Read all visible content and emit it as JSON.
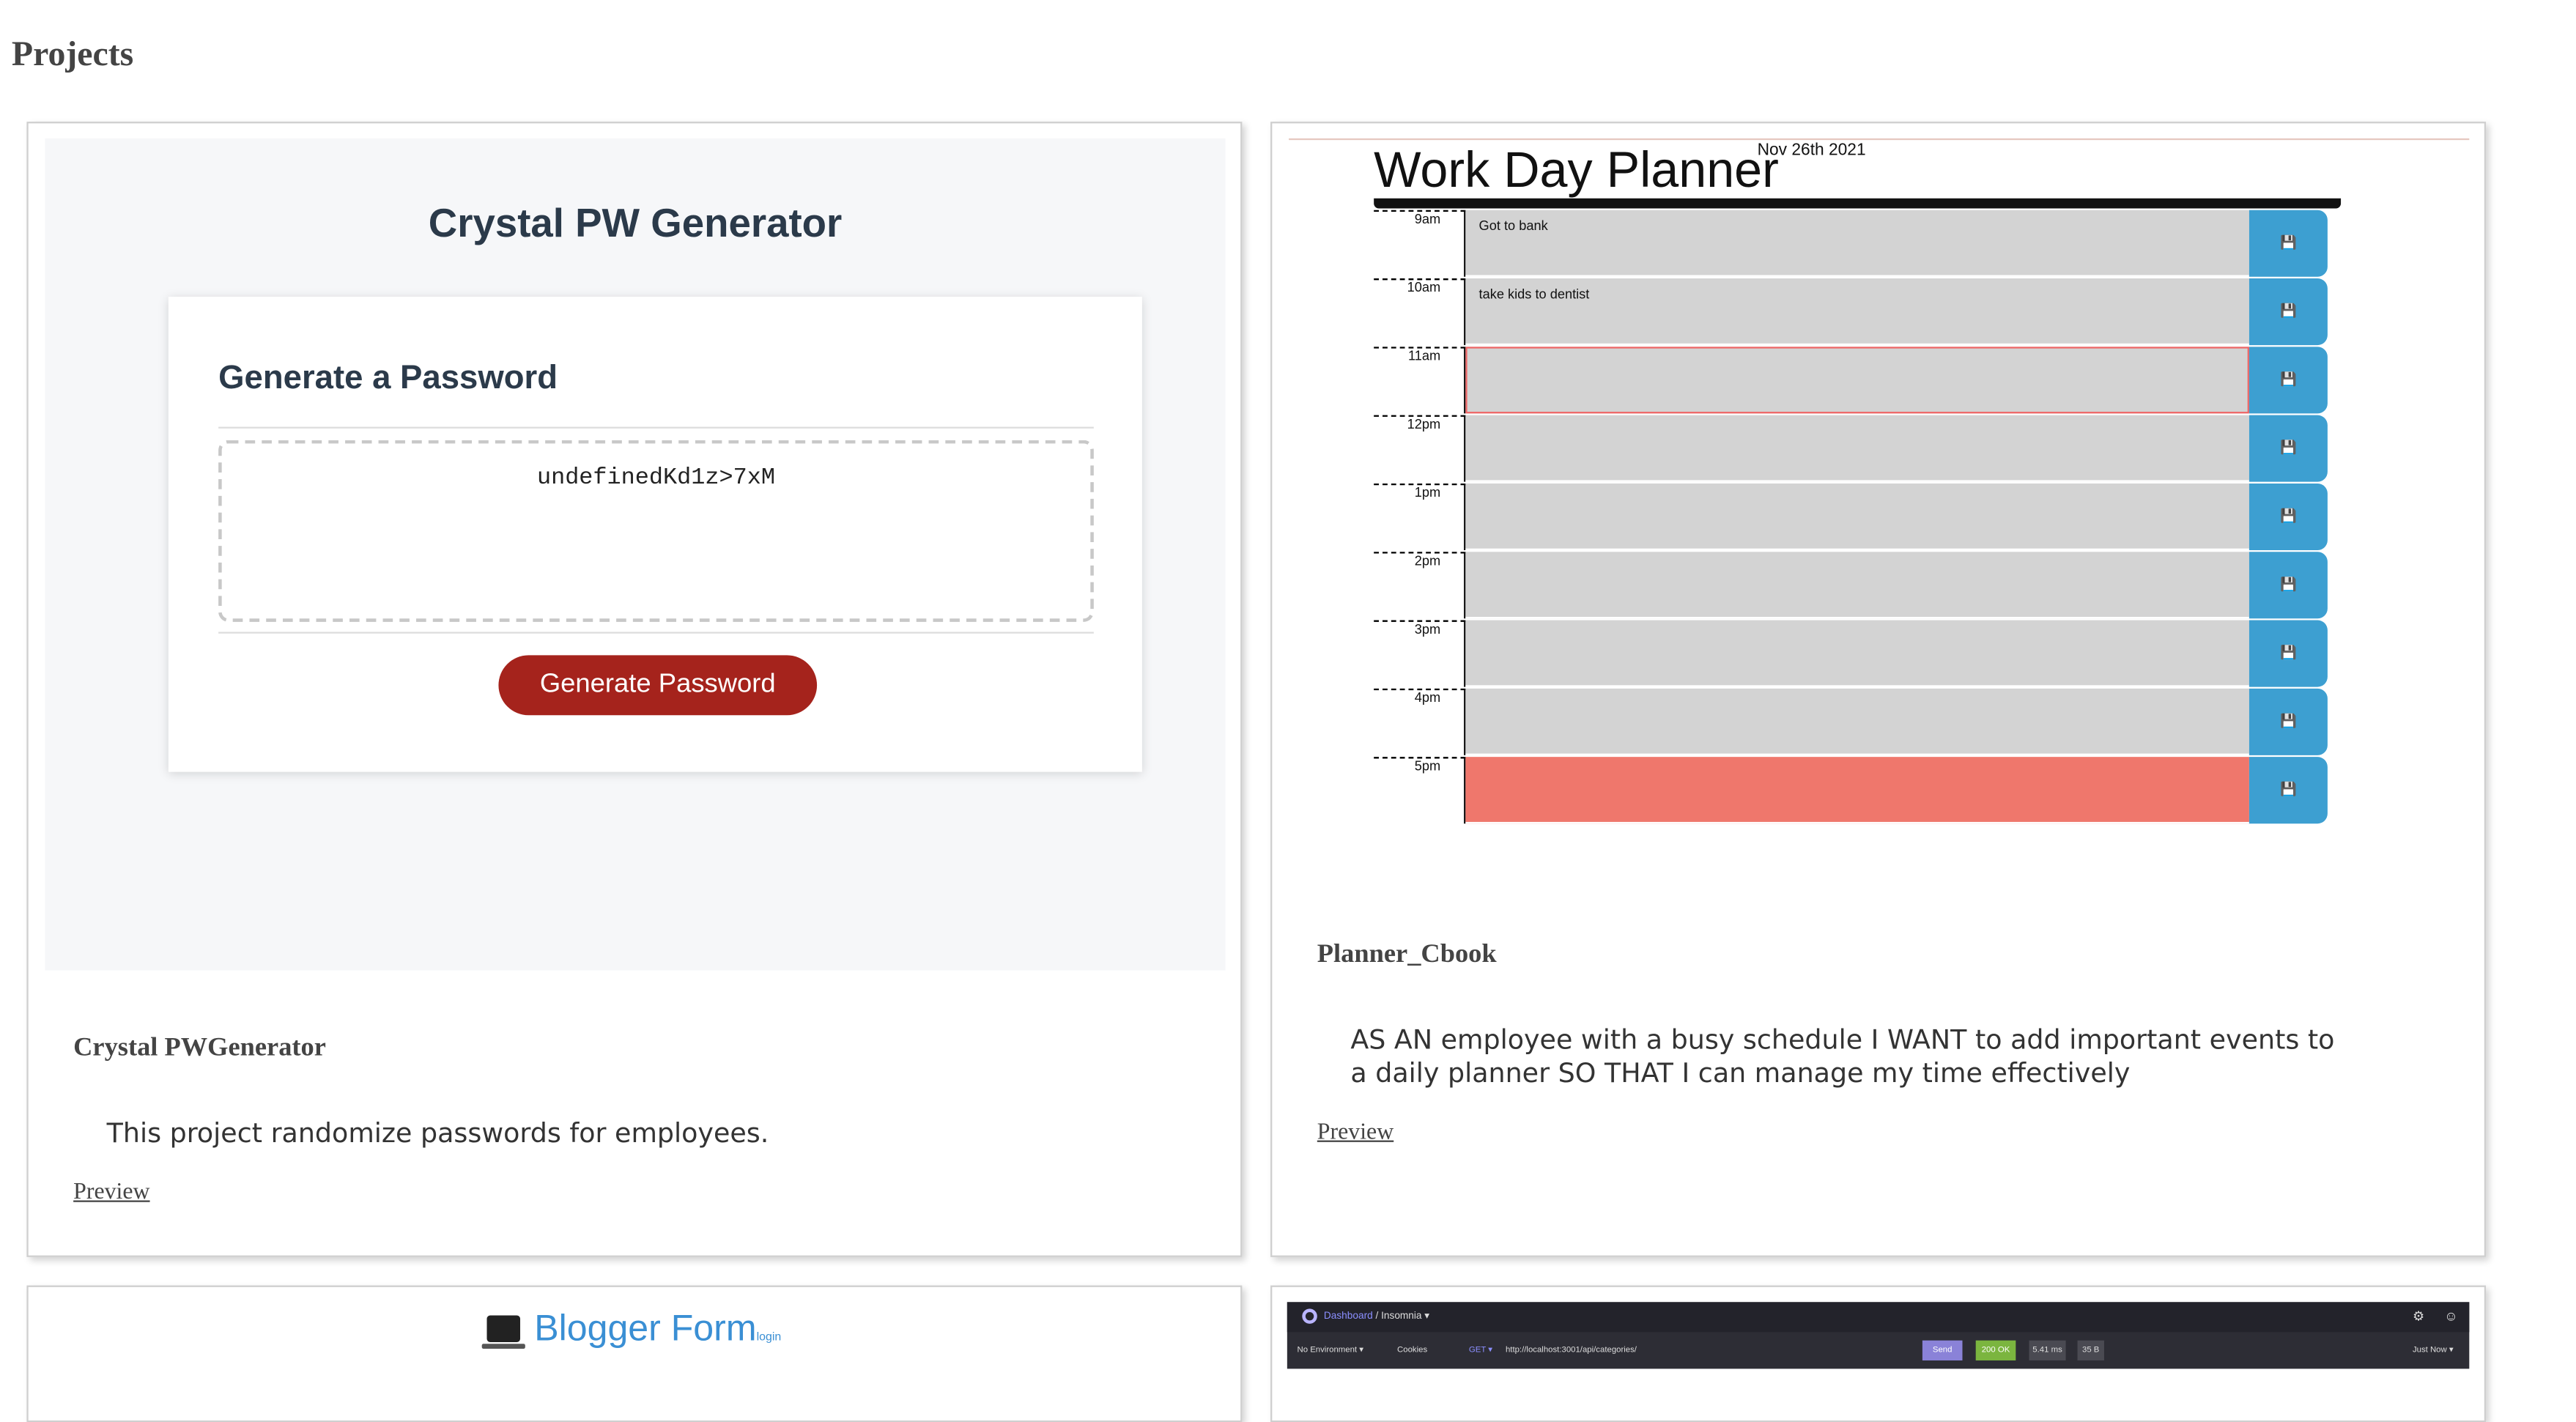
{
  "page": {
    "heading": "Projects"
  },
  "projects": [
    {
      "title": "Crystal PWGenerator",
      "description": "This project randomize passwords for employees.",
      "link": "Preview",
      "preview": {
        "title": "Crystal PW Generator",
        "card_heading": "Generate a Password",
        "password_value": "undefinedKd1z>7xM",
        "button_label": "Generate Password",
        "button_color": "#a5231c"
      }
    },
    {
      "title": "Planner_Cbook",
      "description": "AS AN employee with a busy schedule I WANT to add important events to a daily planner SO THAT I can manage my time effectively",
      "link": "Preview",
      "preview": {
        "title": "Work Day Planner",
        "date": "Nov 26th 2021",
        "save_icon": "save-icon",
        "rows": [
          {
            "hour": "9am",
            "task": "Got to bank",
            "state": "past"
          },
          {
            "hour": "10am",
            "task": "take kids to dentist",
            "state": "past"
          },
          {
            "hour": "11am",
            "task": "",
            "state": "present"
          },
          {
            "hour": "12pm",
            "task": "",
            "state": "past"
          },
          {
            "hour": "1pm",
            "task": "",
            "state": "past"
          },
          {
            "hour": "2pm",
            "task": "",
            "state": "past"
          },
          {
            "hour": "3pm",
            "task": "",
            "state": "past"
          },
          {
            "hour": "4pm",
            "task": "",
            "state": "past"
          },
          {
            "hour": "5pm",
            "task": "",
            "state": "future"
          }
        ],
        "colors": {
          "past": "#d3d3d3",
          "future": "#ef776c",
          "save": "#3d9fd1"
        }
      }
    },
    {
      "preview": {
        "title": "Blogger Form",
        "login": "login",
        "icon": "laptop-icon"
      }
    },
    {
      "preview": {
        "breadcrumb_dashboard": "Dashboard",
        "breadcrumb_app": "/ Insomnia ▾",
        "environment": "No Environment ▾",
        "cookies": "Cookies",
        "method": "GET ▾",
        "url": "http://localhost:3001/api/categories/",
        "send": "Send",
        "status": "200 OK",
        "time": "5.41 ms",
        "size": "35 B",
        "when": "Just Now ▾"
      }
    }
  ]
}
